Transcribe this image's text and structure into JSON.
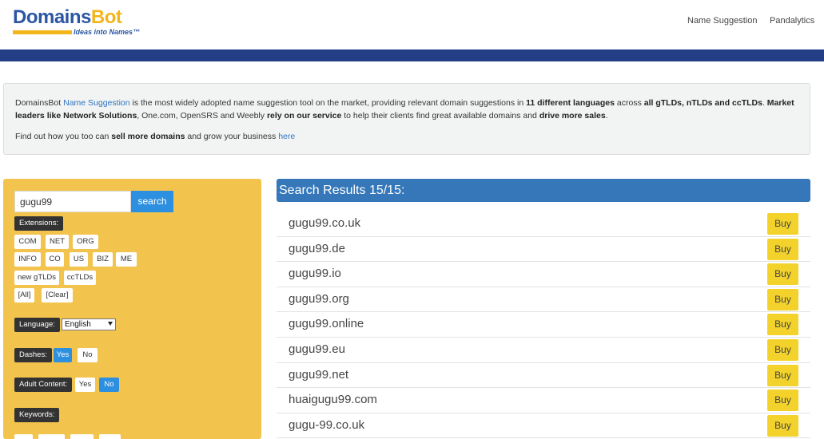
{
  "header": {
    "logo_part1": "Domains",
    "logo_part2": "Bot",
    "logo_tagline": "Ideas into Names™",
    "nav": [
      "Name Suggestion",
      "Pandalytics"
    ]
  },
  "info": {
    "p1_a": "DomainsBot ",
    "p1_link": "Name Suggestion",
    "p1_b": " is the most widely adopted name suggestion tool on the market, providing relevant domain suggestions in ",
    "p1_bold1": "11 different languages",
    "p1_c": " across ",
    "p1_bold2": "all gTLDs, nTLDs and ccTLDs",
    "p1_d": ". ",
    "p1_bold3": "Market leaders like Network Solutions",
    "p1_e": ", One.com, OpenSRS and Weebly ",
    "p1_bold4": "rely on our service",
    "p1_f": " to help their clients find great available domains and ",
    "p1_bold5": "drive more sales",
    "p1_g": ".",
    "p2_a": "Find out how you too can ",
    "p2_bold": "sell more domains",
    "p2_b": " and grow your business ",
    "p2_link": "here"
  },
  "search": {
    "value": "gugu99",
    "button_label": "search"
  },
  "filters": {
    "extensions_label": "Extensions:",
    "extensions": [
      "COM",
      "NET",
      "ORG",
      "INFO",
      "CO",
      "US",
      "BIZ",
      "ME",
      "new gTLDs",
      "ccTLDs",
      "[All]",
      "[Clear]"
    ],
    "language_label": "Language:",
    "language_value": "English",
    "dashes_label": "Dashes:",
    "dashes_yes": "Yes",
    "dashes_no": "No",
    "dashes_selected": "Yes",
    "adult_label": "Adult Content:",
    "adult_yes": "Yes",
    "adult_no": "No",
    "adult_selected": "No",
    "keywords_label": "Keywords:"
  },
  "results": {
    "title": "Search Results 15/15:",
    "buy_label": "Buy",
    "items": [
      "gugu99.co.uk",
      "gugu99.de",
      "gugu99.io",
      "gugu99.org",
      "gugu99.online",
      "gugu99.eu",
      "gugu99.net",
      "huaigugu99.com",
      "gugu-99.co.uk"
    ]
  },
  "colors": {
    "brand_blue": "#2b56a3",
    "brand_yellow": "#f2b51c",
    "band_blue": "#233e86",
    "panel_yellow": "#f2c44d",
    "button_blue": "#2d8fe0",
    "results_blue": "#3577b9",
    "buy_yellow": "#f2d22b"
  }
}
